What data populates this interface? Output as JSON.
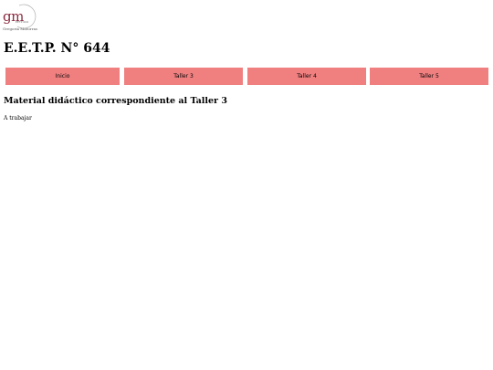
{
  "logo": {
    "mark": "gm",
    "sub": "EETP 644",
    "name": "Gregoria Matorras"
  },
  "header": {
    "title": "E.E.T.P. N° 644"
  },
  "nav": {
    "items": [
      {
        "label": "Inicio"
      },
      {
        "label": "Taller 3"
      },
      {
        "label": "Taller 4"
      },
      {
        "label": "Taller 5"
      }
    ]
  },
  "main": {
    "heading": "Material didáctico correspondiente al Taller 3",
    "text": "A trabajar"
  },
  "colors": {
    "nav_background": "#f08080",
    "logo_accent": "#8b2a3e"
  }
}
